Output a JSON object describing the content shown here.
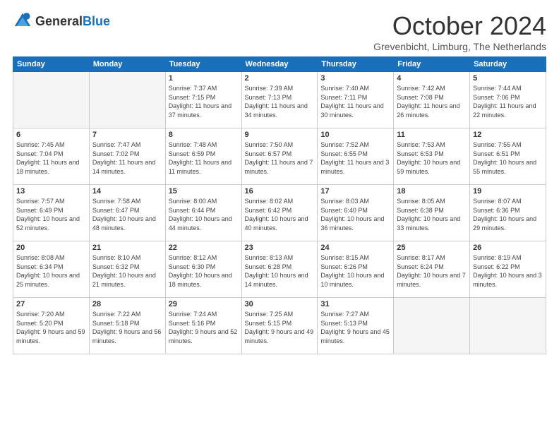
{
  "header": {
    "logo_general": "General",
    "logo_blue": "Blue",
    "title": "October 2024",
    "subtitle": "Grevenbicht, Limburg, The Netherlands"
  },
  "days_of_week": [
    "Sunday",
    "Monday",
    "Tuesday",
    "Wednesday",
    "Thursday",
    "Friday",
    "Saturday"
  ],
  "weeks": [
    [
      {
        "day": "",
        "info": ""
      },
      {
        "day": "",
        "info": ""
      },
      {
        "day": "1",
        "info": "Sunrise: 7:37 AM\nSunset: 7:15 PM\nDaylight: 11 hours and 37 minutes."
      },
      {
        "day": "2",
        "info": "Sunrise: 7:39 AM\nSunset: 7:13 PM\nDaylight: 11 hours and 34 minutes."
      },
      {
        "day": "3",
        "info": "Sunrise: 7:40 AM\nSunset: 7:11 PM\nDaylight: 11 hours and 30 minutes."
      },
      {
        "day": "4",
        "info": "Sunrise: 7:42 AM\nSunset: 7:08 PM\nDaylight: 11 hours and 26 minutes."
      },
      {
        "day": "5",
        "info": "Sunrise: 7:44 AM\nSunset: 7:06 PM\nDaylight: 11 hours and 22 minutes."
      }
    ],
    [
      {
        "day": "6",
        "info": "Sunrise: 7:45 AM\nSunset: 7:04 PM\nDaylight: 11 hours and 18 minutes."
      },
      {
        "day": "7",
        "info": "Sunrise: 7:47 AM\nSunset: 7:02 PM\nDaylight: 11 hours and 14 minutes."
      },
      {
        "day": "8",
        "info": "Sunrise: 7:48 AM\nSunset: 6:59 PM\nDaylight: 11 hours and 11 minutes."
      },
      {
        "day": "9",
        "info": "Sunrise: 7:50 AM\nSunset: 6:57 PM\nDaylight: 11 hours and 7 minutes."
      },
      {
        "day": "10",
        "info": "Sunrise: 7:52 AM\nSunset: 6:55 PM\nDaylight: 11 hours and 3 minutes."
      },
      {
        "day": "11",
        "info": "Sunrise: 7:53 AM\nSunset: 6:53 PM\nDaylight: 10 hours and 59 minutes."
      },
      {
        "day": "12",
        "info": "Sunrise: 7:55 AM\nSunset: 6:51 PM\nDaylight: 10 hours and 55 minutes."
      }
    ],
    [
      {
        "day": "13",
        "info": "Sunrise: 7:57 AM\nSunset: 6:49 PM\nDaylight: 10 hours and 52 minutes."
      },
      {
        "day": "14",
        "info": "Sunrise: 7:58 AM\nSunset: 6:47 PM\nDaylight: 10 hours and 48 minutes."
      },
      {
        "day": "15",
        "info": "Sunrise: 8:00 AM\nSunset: 6:44 PM\nDaylight: 10 hours and 44 minutes."
      },
      {
        "day": "16",
        "info": "Sunrise: 8:02 AM\nSunset: 6:42 PM\nDaylight: 10 hours and 40 minutes."
      },
      {
        "day": "17",
        "info": "Sunrise: 8:03 AM\nSunset: 6:40 PM\nDaylight: 10 hours and 36 minutes."
      },
      {
        "day": "18",
        "info": "Sunrise: 8:05 AM\nSunset: 6:38 PM\nDaylight: 10 hours and 33 minutes."
      },
      {
        "day": "19",
        "info": "Sunrise: 8:07 AM\nSunset: 6:36 PM\nDaylight: 10 hours and 29 minutes."
      }
    ],
    [
      {
        "day": "20",
        "info": "Sunrise: 8:08 AM\nSunset: 6:34 PM\nDaylight: 10 hours and 25 minutes."
      },
      {
        "day": "21",
        "info": "Sunrise: 8:10 AM\nSunset: 6:32 PM\nDaylight: 10 hours and 21 minutes."
      },
      {
        "day": "22",
        "info": "Sunrise: 8:12 AM\nSunset: 6:30 PM\nDaylight: 10 hours and 18 minutes."
      },
      {
        "day": "23",
        "info": "Sunrise: 8:13 AM\nSunset: 6:28 PM\nDaylight: 10 hours and 14 minutes."
      },
      {
        "day": "24",
        "info": "Sunrise: 8:15 AM\nSunset: 6:26 PM\nDaylight: 10 hours and 10 minutes."
      },
      {
        "day": "25",
        "info": "Sunrise: 8:17 AM\nSunset: 6:24 PM\nDaylight: 10 hours and 7 minutes."
      },
      {
        "day": "26",
        "info": "Sunrise: 8:19 AM\nSunset: 6:22 PM\nDaylight: 10 hours and 3 minutes."
      }
    ],
    [
      {
        "day": "27",
        "info": "Sunrise: 7:20 AM\nSunset: 5:20 PM\nDaylight: 9 hours and 59 minutes."
      },
      {
        "day": "28",
        "info": "Sunrise: 7:22 AM\nSunset: 5:18 PM\nDaylight: 9 hours and 56 minutes."
      },
      {
        "day": "29",
        "info": "Sunrise: 7:24 AM\nSunset: 5:16 PM\nDaylight: 9 hours and 52 minutes."
      },
      {
        "day": "30",
        "info": "Sunrise: 7:25 AM\nSunset: 5:15 PM\nDaylight: 9 hours and 49 minutes."
      },
      {
        "day": "31",
        "info": "Sunrise: 7:27 AM\nSunset: 5:13 PM\nDaylight: 9 hours and 45 minutes."
      },
      {
        "day": "",
        "info": ""
      },
      {
        "day": "",
        "info": ""
      }
    ]
  ]
}
